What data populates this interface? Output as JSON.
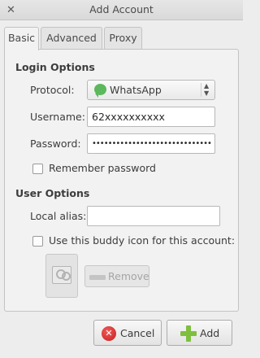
{
  "window": {
    "title": "Add Account",
    "close_icon": "close-icon"
  },
  "tabs": [
    {
      "label": "Basic",
      "active": true
    },
    {
      "label": "Advanced",
      "active": false
    },
    {
      "label": "Proxy",
      "active": false
    }
  ],
  "login_options": {
    "heading": "Login Options",
    "protocol_label": "Protocol:",
    "protocol_value": "WhatsApp",
    "protocol_icon": "whatsapp-icon",
    "username_label": "Username:",
    "username_value": "62xxxxxxxxxx",
    "password_label": "Password:",
    "password_value": "••••••••••••••••••••••••••••••",
    "remember_label": "Remember password",
    "remember_checked": false
  },
  "user_options": {
    "heading": "User Options",
    "alias_label": "Local alias:",
    "alias_value": "",
    "buddy_icon_label": "Use this buddy icon for this account:",
    "buddy_icon_checked": false,
    "remove_label": "Remove"
  },
  "buttons": {
    "cancel_label": "Cancel",
    "add_label": "Add"
  },
  "colors": {
    "accent_green": "#7fbf3f",
    "cancel_red": "#c81e1e",
    "whatsapp_green": "#5cb85c"
  }
}
